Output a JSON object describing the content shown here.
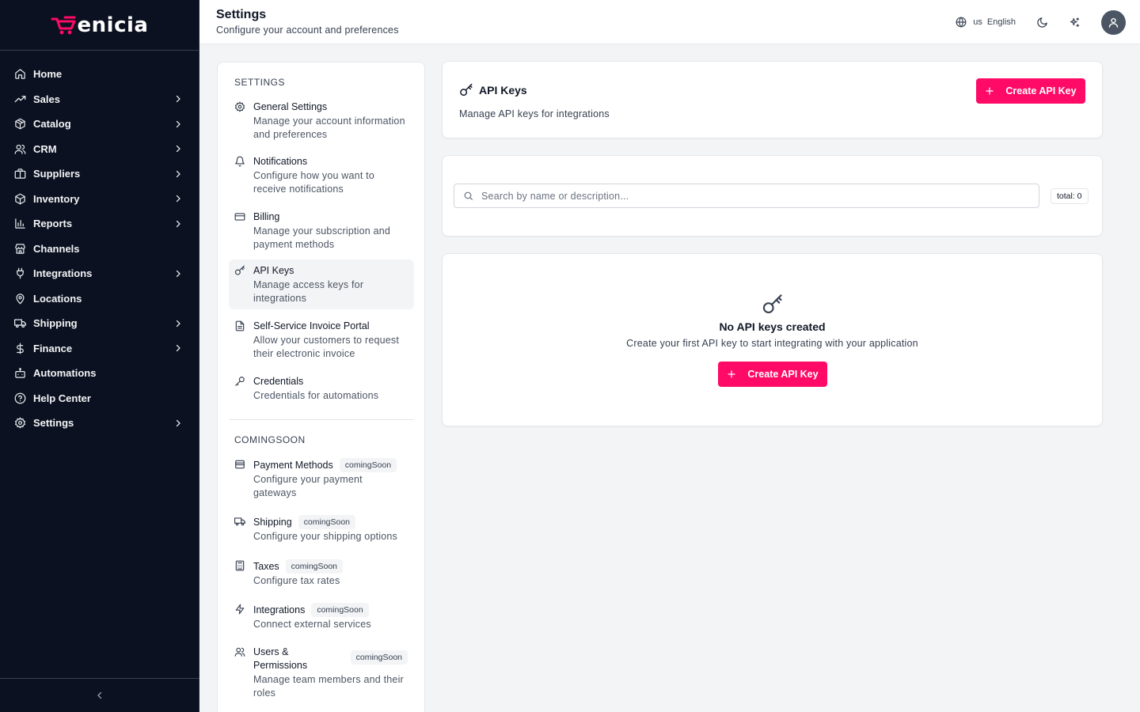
{
  "brand": {
    "name": "enicia",
    "accent": "#ff0a66"
  },
  "sidebar": {
    "items": [
      {
        "label": "Home",
        "icon": "home-icon",
        "chevron": false
      },
      {
        "label": "Sales",
        "icon": "trending-up-icon",
        "chevron": true
      },
      {
        "label": "Catalog",
        "icon": "package-icon",
        "chevron": true
      },
      {
        "label": "CRM",
        "icon": "users-icon",
        "chevron": true
      },
      {
        "label": "Suppliers",
        "icon": "briefcase-icon",
        "chevron": true
      },
      {
        "label": "Inventory",
        "icon": "box-icon",
        "chevron": true
      },
      {
        "label": "Reports",
        "icon": "bar-chart-icon",
        "chevron": true
      },
      {
        "label": "Channels",
        "icon": "store-icon",
        "chevron": false
      },
      {
        "label": "Integrations",
        "icon": "plug-icon",
        "chevron": true
      },
      {
        "label": "Locations",
        "icon": "map-pin-icon",
        "chevron": false
      },
      {
        "label": "Shipping",
        "icon": "truck-icon",
        "chevron": true
      },
      {
        "label": "Finance",
        "icon": "dollar-icon",
        "chevron": true
      },
      {
        "label": "Automations",
        "icon": "bot-icon",
        "chevron": false
      },
      {
        "label": "Help Center",
        "icon": "help-circle-icon",
        "chevron": false
      },
      {
        "label": "Settings",
        "icon": "gear-icon",
        "chevron": true
      }
    ]
  },
  "header": {
    "title": "Settings",
    "subtitle": "Configure your account and preferences",
    "lang_code": "us",
    "lang_label": "English"
  },
  "settings_nav": {
    "section1": "SETTINGS",
    "items": [
      {
        "title": "General Settings",
        "desc": "Manage your account information and preferences"
      },
      {
        "title": "Notifications",
        "desc": "Configure how you want to receive notifications"
      },
      {
        "title": "Billing",
        "desc": "Manage your subscription and payment methods"
      },
      {
        "title": "API Keys",
        "desc": "Manage access keys for integrations"
      },
      {
        "title": "Self-Service Invoice Portal",
        "desc": "Allow your customers to request their electronic invoice"
      },
      {
        "title": "Credentials",
        "desc": "Credentials for automations"
      }
    ],
    "section2": "COMINGSOON",
    "coming": [
      {
        "title": "Payment Methods",
        "badge": "comingSoon",
        "desc": "Configure your payment gateways"
      },
      {
        "title": "Shipping",
        "badge": "comingSoon",
        "desc": "Configure your shipping options"
      },
      {
        "title": "Taxes",
        "badge": "comingSoon",
        "desc": "Configure tax rates"
      },
      {
        "title": "Integrations",
        "badge": "comingSoon",
        "desc": "Connect external services"
      },
      {
        "title": "Users & Permissions",
        "badge": "comingSoon",
        "desc": "Manage team members and their roles"
      }
    ]
  },
  "api_keys": {
    "title": "API Keys",
    "subtitle": "Manage API keys for integrations",
    "create_label": "Create API Key",
    "search_placeholder": "Search by name or description...",
    "search_value": "",
    "total_label": "total: 0",
    "empty_title": "No API keys created",
    "empty_sub": "Create your first API key to start integrating with your application",
    "empty_create_label": "Create API Key"
  }
}
